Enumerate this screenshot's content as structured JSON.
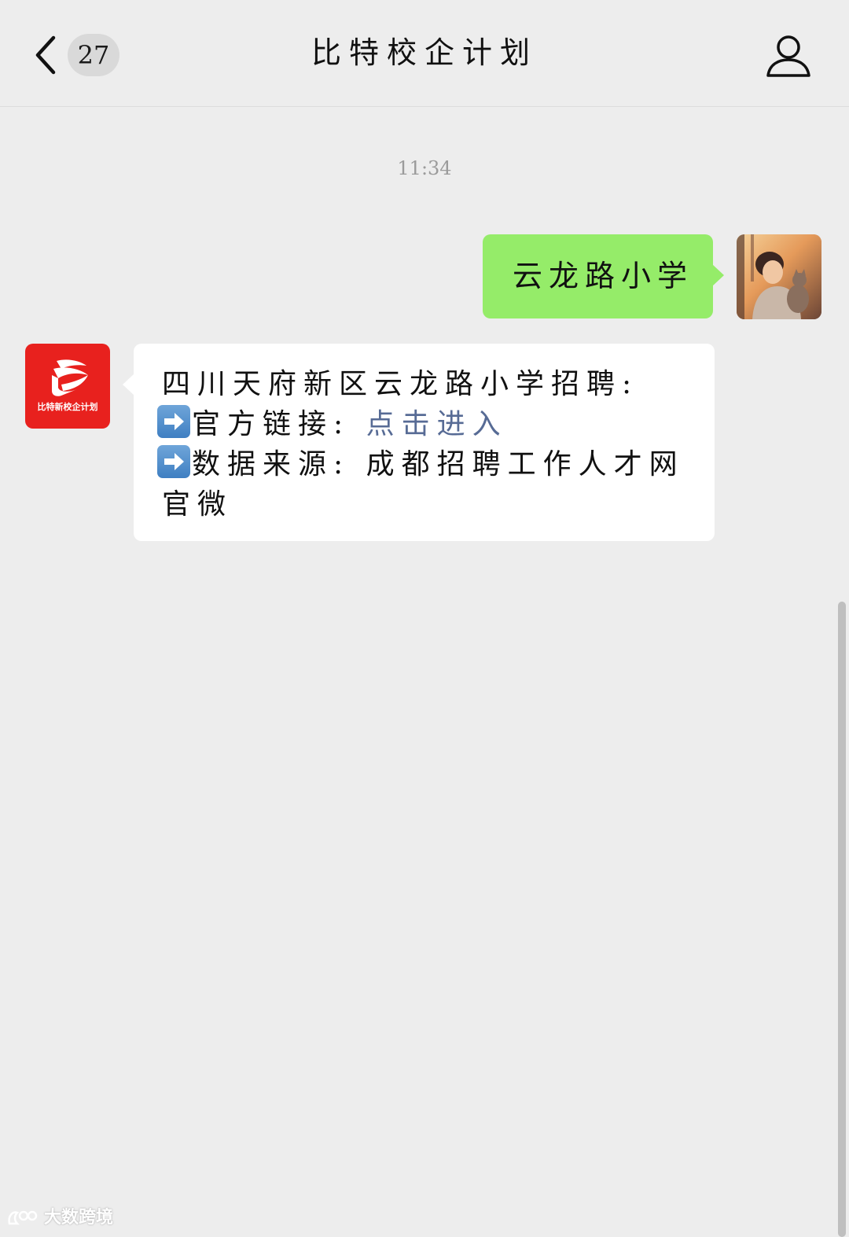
{
  "navbar": {
    "unread_count": "27",
    "title": "比特校企计划"
  },
  "chat": {
    "timestamp": "11:34",
    "outgoing_message": "云龙路小学",
    "incoming_message": {
      "line1": "四川天府新区云龙路小学招聘:",
      "line2_label": "官方链接: ",
      "line2_link": "点击进入",
      "line3": "数据来源: 成都招聘工作人才网官微"
    }
  },
  "avatar_bot_label": "比特新校企计划",
  "watermark": "大数跨境",
  "colors": {
    "background": "#ededed",
    "outgoing_bubble": "#95ec69",
    "incoming_bubble": "#ffffff",
    "link": "#576b95",
    "bot_avatar": "#e8211e"
  },
  "icons": [
    "back-chevron-icon",
    "profile-icon",
    "right-arrow-emoji-icon"
  ]
}
